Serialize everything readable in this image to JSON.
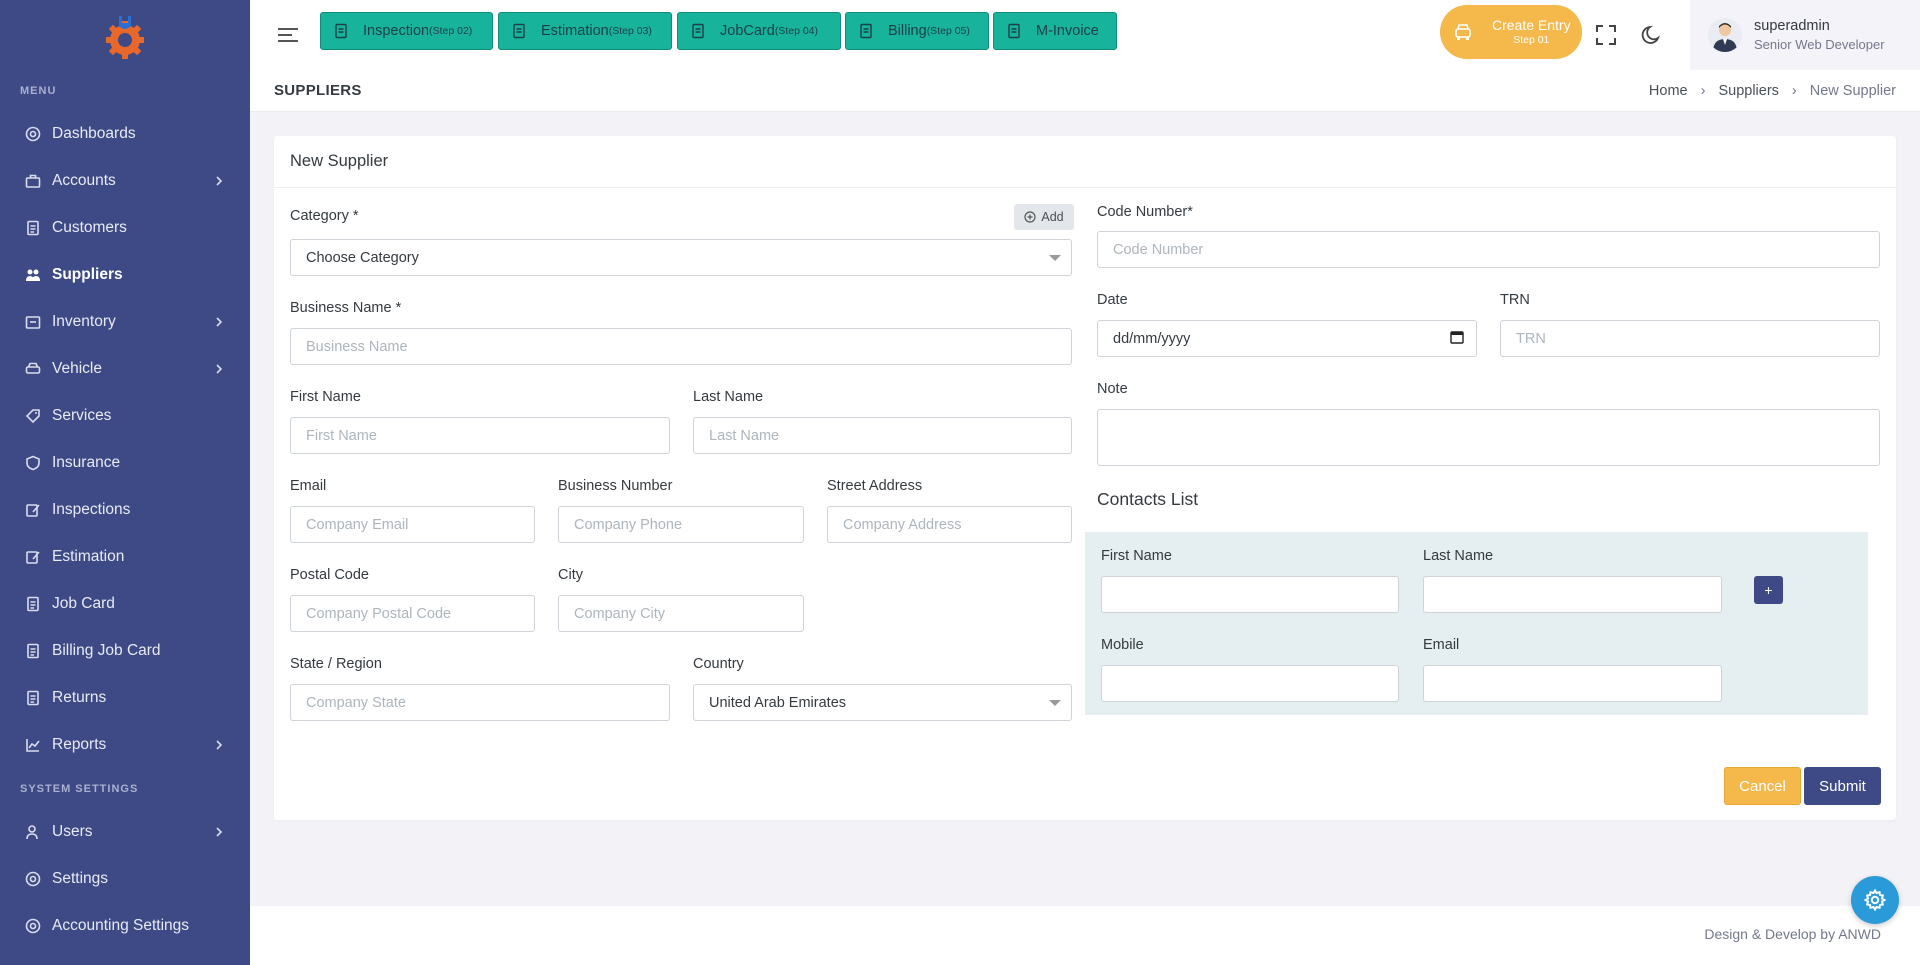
{
  "sidebar": {
    "menu_title": "MENU",
    "system_title": "SYSTEM SETTINGS",
    "items": [
      {
        "label": "Dashboards",
        "icon": "dashboard-icon",
        "chevron": false,
        "active": false
      },
      {
        "label": "Accounts",
        "icon": "briefcase-icon",
        "chevron": true,
        "active": false
      },
      {
        "label": "Customers",
        "icon": "document-icon",
        "chevron": false,
        "active": false
      },
      {
        "label": "Suppliers",
        "icon": "users-icon",
        "chevron": false,
        "active": true
      },
      {
        "label": "Inventory",
        "icon": "inventory-icon",
        "chevron": true,
        "active": false
      },
      {
        "label": "Vehicle",
        "icon": "car-icon",
        "chevron": true,
        "active": false
      },
      {
        "label": "Services",
        "icon": "tag-icon",
        "chevron": false,
        "active": false
      },
      {
        "label": "Insurance",
        "icon": "shield-icon",
        "chevron": false,
        "active": false
      },
      {
        "label": "Inspections",
        "icon": "edit-icon",
        "chevron": false,
        "active": false
      },
      {
        "label": "Estimation",
        "icon": "estimation-icon",
        "chevron": false,
        "active": false
      },
      {
        "label": "Job Card",
        "icon": "file-icon",
        "chevron": false,
        "active": false
      },
      {
        "label": "Billing Job Card",
        "icon": "file-icon",
        "chevron": false,
        "active": false
      },
      {
        "label": "Returns",
        "icon": "file-icon",
        "chevron": false,
        "active": false
      },
      {
        "label": "Reports",
        "icon": "chart-icon",
        "chevron": true,
        "active": false
      }
    ],
    "system_items": [
      {
        "label": "Users",
        "icon": "user-icon",
        "chevron": true
      },
      {
        "label": "Settings",
        "icon": "gear-icon",
        "chevron": false
      },
      {
        "label": "Accounting Settings",
        "icon": "gear-icon",
        "chevron": false
      }
    ]
  },
  "topbar": {
    "steps": [
      {
        "label": "Inspection",
        "sub": "(Step 02)"
      },
      {
        "label": "Estimation",
        "sub": "(Step 03)"
      },
      {
        "label": "JobCard",
        "sub": "(Step 04)"
      },
      {
        "label": "Billing",
        "sub": "(Step 05)"
      },
      {
        "label": "M-Invoice",
        "sub": ""
      }
    ],
    "create_entry": "Create Entry",
    "create_entry_sub": "Step 01",
    "user_name": "superadmin",
    "user_role": "Senior Web Developer"
  },
  "page": {
    "title": "SUPPLIERS",
    "breadcrumb": [
      "Home",
      "Suppliers",
      "New Supplier"
    ]
  },
  "form": {
    "header": "New Supplier",
    "category_label": "Category *",
    "add_label": "Add",
    "category_value": "Choose Category",
    "business_name_label": "Business Name *",
    "business_name_placeholder": "Business Name",
    "first_name_label": "First Name",
    "first_name_placeholder": "First Name",
    "last_name_label": "Last Name",
    "last_name_placeholder": "Last Name",
    "email_label": "Email",
    "email_placeholder": "Company Email",
    "business_number_label": "Business Number",
    "business_number_placeholder": "Company Phone",
    "street_label": "Street Address",
    "street_placeholder": "Company Address",
    "postal_label": "Postal Code",
    "postal_placeholder": "Company Postal Code",
    "city_label": "City",
    "city_placeholder": "Company City",
    "state_label": "State / Region",
    "state_placeholder": "Company State",
    "country_label": "Country",
    "country_value": "United Arab Emirates",
    "code_label": "Code Number*",
    "code_placeholder": "Code Number",
    "date_label": "Date",
    "date_value": "dd/mm/yyyy",
    "trn_label": "TRN",
    "trn_placeholder": "TRN",
    "note_label": "Note",
    "contacts_title": "Contacts List",
    "contact_first_label": "First Name",
    "contact_last_label": "Last Name",
    "contact_mobile_label": "Mobile",
    "contact_email_label": "Email",
    "plus_label": "+",
    "cancel_label": "Cancel",
    "submit_label": "Submit"
  },
  "footer": {
    "text": "Design & Develop by ANWD"
  }
}
